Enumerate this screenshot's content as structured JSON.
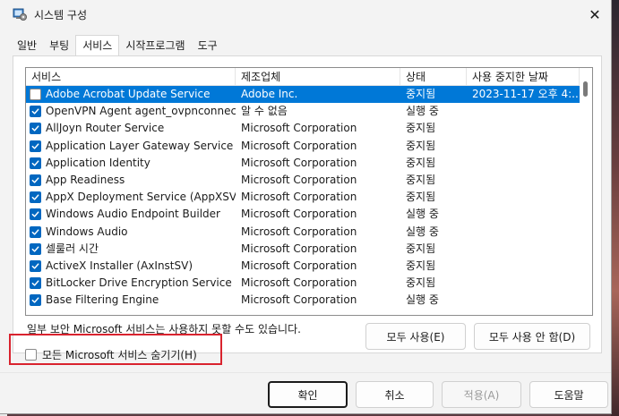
{
  "window": {
    "title": "시스템 구성",
    "close_glyph": "✕"
  },
  "tabs": [
    {
      "label": "일반"
    },
    {
      "label": "부팅"
    },
    {
      "label": "서비스"
    },
    {
      "label": "시작프로그램"
    },
    {
      "label": "도구"
    }
  ],
  "active_tab": "서비스",
  "list": {
    "headers": [
      "서비스",
      "제조업체",
      "상태",
      "사용 중지한 날짜"
    ],
    "rows": [
      {
        "service": "Adobe Acrobat Update Service",
        "manufacturer": "Adobe Inc.",
        "status": "중지됨",
        "date": "2023-11-17 오후 4:...",
        "checked": false,
        "selected": true
      },
      {
        "service": "OpenVPN Agent agent_ovpnconnect",
        "manufacturer": "알 수 없음",
        "status": "실행 중",
        "date": "",
        "checked": true,
        "selected": false
      },
      {
        "service": "AllJoyn Router Service",
        "manufacturer": "Microsoft Corporation",
        "status": "중지됨",
        "date": "",
        "checked": true,
        "selected": false
      },
      {
        "service": "Application Layer Gateway Service",
        "manufacturer": "Microsoft Corporation",
        "status": "중지됨",
        "date": "",
        "checked": true,
        "selected": false
      },
      {
        "service": "Application Identity",
        "manufacturer": "Microsoft Corporation",
        "status": "중지됨",
        "date": "",
        "checked": true,
        "selected": false
      },
      {
        "service": "App Readiness",
        "manufacturer": "Microsoft Corporation",
        "status": "중지됨",
        "date": "",
        "checked": true,
        "selected": false
      },
      {
        "service": "AppX Deployment Service (AppXSVC)",
        "manufacturer": "Microsoft Corporation",
        "status": "중지됨",
        "date": "",
        "checked": true,
        "selected": false
      },
      {
        "service": "Windows Audio Endpoint Builder",
        "manufacturer": "Microsoft Corporation",
        "status": "실행 중",
        "date": "",
        "checked": true,
        "selected": false
      },
      {
        "service": "Windows Audio",
        "manufacturer": "Microsoft Corporation",
        "status": "실행 중",
        "date": "",
        "checked": true,
        "selected": false
      },
      {
        "service": "셀룰러 시간",
        "manufacturer": "Microsoft Corporation",
        "status": "중지됨",
        "date": "",
        "checked": true,
        "selected": false
      },
      {
        "service": "ActiveX Installer (AxInstSV)",
        "manufacturer": "Microsoft Corporation",
        "status": "중지됨",
        "date": "",
        "checked": true,
        "selected": false
      },
      {
        "service": "BitLocker Drive Encryption Service",
        "manufacturer": "Microsoft Corporation",
        "status": "중지됨",
        "date": "",
        "checked": true,
        "selected": false
      },
      {
        "service": "Base Filtering Engine",
        "manufacturer": "Microsoft Corporation",
        "status": "실행 중",
        "date": "",
        "checked": true,
        "selected": false
      }
    ]
  },
  "note": "일부 보안 Microsoft 서비스는 사용하지 못할 수도 있습니다.",
  "buttons": {
    "enable_all": "모두 사용(E)",
    "disable_all": "모두 사용 안 함(D)",
    "ok": "확인",
    "cancel": "취소",
    "apply": "적용(A)",
    "help": "도움말"
  },
  "hide_ms": {
    "label": "모든 Microsoft 서비스 숨기기(H)",
    "checked": false
  },
  "colors": {
    "selection": "#0078d7",
    "checkbox_on": "#0067c0",
    "highlight_box": "#d9232e"
  }
}
